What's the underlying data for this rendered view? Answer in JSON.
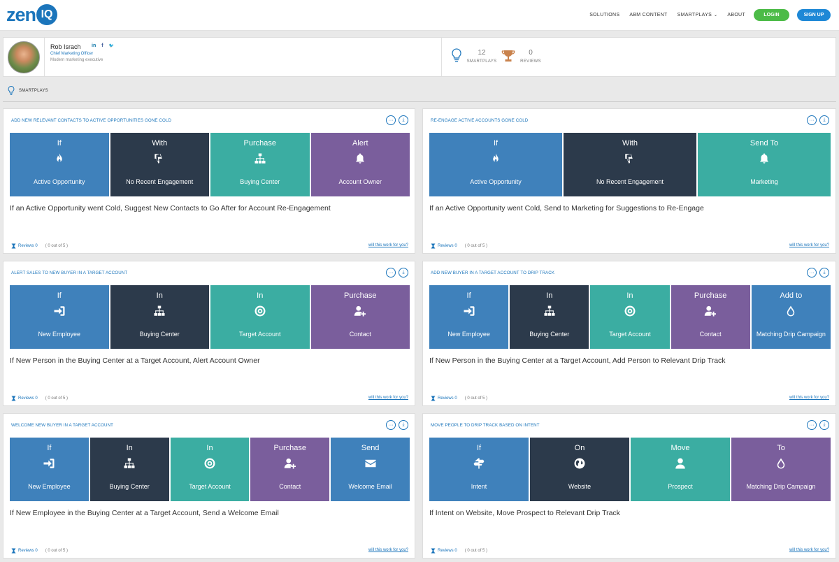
{
  "brand": {
    "logo_main": "zen",
    "logo_circle": "IQ"
  },
  "nav": {
    "items": [
      "SOLUTIONS",
      "ABM CONTENT",
      "SMARTPLAYS",
      "ABOUT"
    ],
    "smartplays_chevron": "⌄",
    "login": "LOGIN",
    "signup": "SIGN UP"
  },
  "profile": {
    "name": "Rob Israch",
    "title": "Chief Marketing Officer",
    "description": "Modern marketing executive",
    "social": [
      "in",
      "f",
      "🐦"
    ],
    "stats": {
      "smartplays_count": "12",
      "smartplays_label": "SMARTPLAYS",
      "reviews_count": "0",
      "reviews_label": "REVIEWS"
    }
  },
  "section": {
    "label": "SMARTPLAYS"
  },
  "card_common": {
    "reviews_label": "Reviews 0",
    "count_label": "( 0 out of 5 )",
    "cta": "will this work for you?",
    "more_icon": "···",
    "download_icon": "⤓"
  },
  "cards": [
    {
      "title": "ADD NEW RELEVANT CONTACTS TO ACTIVE OPPORTUNITIES GONE COLD",
      "tiles": [
        {
          "word": "If",
          "label": "Active Opportunity",
          "icon": "fire-icon"
        },
        {
          "word": "With",
          "label": "No Recent Engagement",
          "icon": "thumbs-down-icon"
        },
        {
          "word": "Purchase",
          "label": "Buying Center",
          "icon": "sitemap-icon"
        },
        {
          "word": "Alert",
          "label": "Account Owner",
          "icon": "bell-icon"
        }
      ],
      "description": "If an Active Opportunity went Cold, Suggest New Contacts to Go After for Account Re-Engagement"
    },
    {
      "title": "RE-ENGAGE ACTIVE ACCOUNTS GONE COLD",
      "tiles": [
        {
          "word": "If",
          "label": "Active Opportunity",
          "icon": "fire-icon"
        },
        {
          "word": "With",
          "label": "No Recent Engagement",
          "icon": "thumbs-down-icon"
        },
        {
          "word": "Send To",
          "label": "Marketing",
          "icon": "bell-icon"
        }
      ],
      "description": "If an Active Opportunity went Cold, Send to Marketing for Suggestions to Re-Engage"
    },
    {
      "title": "ALERT SALES TO NEW BUYER IN A TARGET ACCOUNT",
      "tiles": [
        {
          "word": "If",
          "label": "New Employee",
          "icon": "sign-in-icon"
        },
        {
          "word": "In",
          "label": "Buying Center",
          "icon": "sitemap-icon"
        },
        {
          "word": "In",
          "label": "Target Account",
          "icon": "target-icon"
        },
        {
          "word": "Purchase",
          "label": "Contact",
          "icon": "add-user-icon"
        }
      ],
      "description": "If New Person in the Buying Center at a Target Account, Alert Account Owner"
    },
    {
      "title": "ADD NEW BUYER IN A TARGET ACCOUNT TO DRIP TRACK",
      "tiles": [
        {
          "word": "If",
          "label": "New Employee",
          "icon": "sign-in-icon"
        },
        {
          "word": "In",
          "label": "Buying Center",
          "icon": "sitemap-icon"
        },
        {
          "word": "In",
          "label": "Target Account",
          "icon": "target-icon"
        },
        {
          "word": "Purchase",
          "label": "Contact",
          "icon": "add-user-icon"
        },
        {
          "word": "Add to",
          "label": "Matching Drip Campaign",
          "icon": "drop-icon"
        }
      ],
      "description": "If New Person in the Buying Center at a Target Account, Add Person to Relevant Drip Track"
    },
    {
      "title": "WELCOME NEW BUYER IN A TARGET ACCOUNT",
      "tiles": [
        {
          "word": "If",
          "label": "New Employee",
          "icon": "sign-in-icon"
        },
        {
          "word": "In",
          "label": "Buying Center",
          "icon": "sitemap-icon"
        },
        {
          "word": "In",
          "label": "Target Account",
          "icon": "target-icon"
        },
        {
          "word": "Purchase",
          "label": "Contact",
          "icon": "add-user-icon"
        },
        {
          "word": "Send",
          "label": "Welcome Email",
          "icon": "envelope-icon"
        }
      ],
      "description": "If New Employee in the Buying Center at a Target Account, Send a Welcome Email"
    },
    {
      "title": "MOVE PEOPLE TO DRIP TRACK BASED ON INTENT",
      "tiles": [
        {
          "word": "If",
          "label": "Intent",
          "icon": "signpost-icon"
        },
        {
          "word": "On",
          "label": "Website",
          "icon": "globe-icon"
        },
        {
          "word": "Move",
          "label": "Prospect",
          "icon": "user-icon"
        },
        {
          "word": "To",
          "label": "Matching Drip Campaign",
          "icon": "drop-icon"
        }
      ],
      "description": "If Intent on Website, Move Prospect to Relevant Drip Track"
    }
  ],
  "colors": {
    "brand_blue": "#1b75bb",
    "tile_blue": "#3f81bb",
    "tile_navy": "#2c3a4b",
    "tile_teal": "#3bada2",
    "tile_purple": "#7a5e9c",
    "login_green": "#4cbb47",
    "signup_blue": "#1e88d6"
  }
}
